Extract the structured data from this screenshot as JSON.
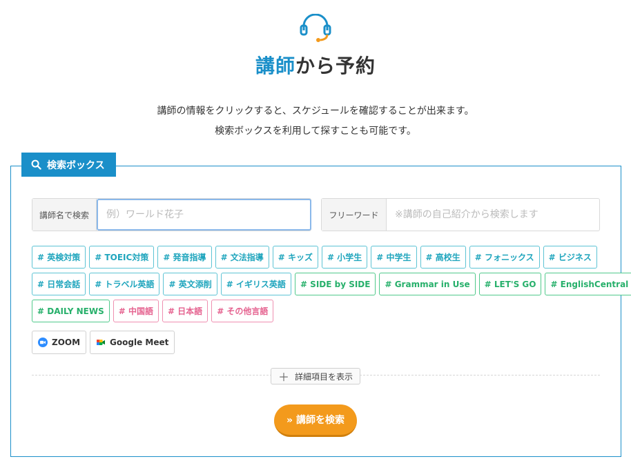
{
  "header": {
    "icon": "headset-icon",
    "title_accent": "講師",
    "title_rest": "から予約",
    "intro_line1": "講師の情報をクリックすると、スケジュールを確認することが出来ます。",
    "intro_line2": "検索ボックスを利用して探すことも可能です。"
  },
  "search_box": {
    "tab_label": "検索ボックス",
    "tab_icon": "search-icon",
    "name_field": {
      "label": "講師名で検索",
      "placeholder": "例）ワールド花子",
      "value": ""
    },
    "free_field": {
      "label": "フリーワード",
      "placeholder": "※講師の自己紹介から検索します",
      "value": ""
    },
    "tags_row1": [
      {
        "label": "# 英検対策",
        "color": "blue"
      },
      {
        "label": "# TOEIC対策",
        "color": "blue"
      },
      {
        "label": "# 発音指導",
        "color": "blue"
      },
      {
        "label": "# 文法指導",
        "color": "blue"
      },
      {
        "label": "# キッズ",
        "color": "blue"
      },
      {
        "label": "# 小学生",
        "color": "blue"
      },
      {
        "label": "# 中学生",
        "color": "blue"
      },
      {
        "label": "# 高校生",
        "color": "blue"
      },
      {
        "label": "# フォニックス",
        "color": "blue"
      },
      {
        "label": "# ビジネス",
        "color": "blue"
      }
    ],
    "tags_row2": [
      {
        "label": "# 日常会話",
        "color": "blue"
      },
      {
        "label": "# トラベル英語",
        "color": "blue"
      },
      {
        "label": "# 英文添削",
        "color": "blue"
      },
      {
        "label": "# イギリス英語",
        "color": "blue"
      },
      {
        "label": "# SIDE by SIDE",
        "color": "green"
      },
      {
        "label": "# Grammar in Use",
        "color": "green"
      },
      {
        "label": "# LET'S GO",
        "color": "green"
      },
      {
        "label": "# EnglishCentral",
        "color": "green"
      }
    ],
    "tags_row3": [
      {
        "label": "# DAILY NEWS",
        "color": "green"
      },
      {
        "label": "# 中国語",
        "color": "pink"
      },
      {
        "label": "# 日本語",
        "color": "pink"
      },
      {
        "label": "# その他言語",
        "color": "pink"
      }
    ],
    "tools": [
      {
        "label": "ZOOM",
        "icon": "zoom-icon"
      },
      {
        "label": "Google Meet",
        "icon": "google-meet-icon"
      }
    ],
    "detail_label": "詳細項目を表示",
    "submit_label": "» 講師を検索"
  },
  "colors": {
    "accent": "#1a8fc9",
    "tag_blue": "#1fa5bd",
    "tag_green": "#27b06b",
    "tag_pink": "#e5628f",
    "submit": "#f39a1c"
  }
}
